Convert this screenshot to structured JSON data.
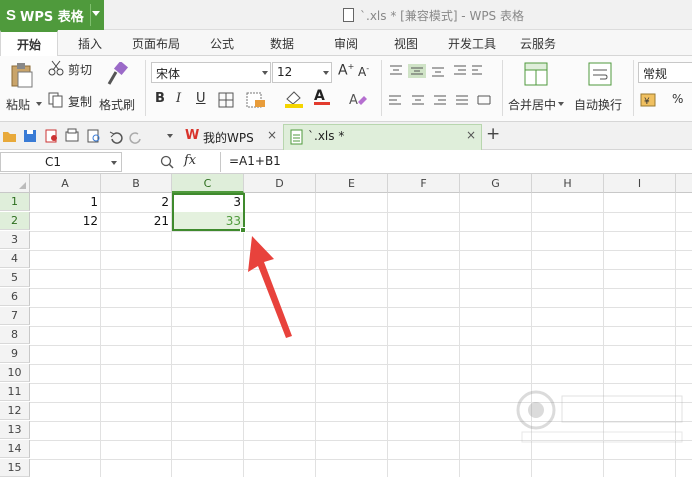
{
  "app": {
    "logo_label": "WPS 表格",
    "window_title": "`.xls * [兼容模式] - WPS 表格"
  },
  "menu": {
    "tabs": [
      "开始",
      "插入",
      "页面布局",
      "公式",
      "数据",
      "审阅",
      "视图",
      "开发工具",
      "云服务"
    ],
    "active": "开始"
  },
  "ribbon": {
    "paste": "粘贴",
    "cut": "剪切",
    "copy": "复制",
    "format_painter": "格式刷",
    "font_name": "宋体",
    "font_size": "12",
    "bold": "B",
    "italic": "I",
    "underline": "U",
    "merge_center": "合并居中",
    "wrap_text": "自动换行",
    "number_format": "常规",
    "percent": "%"
  },
  "doc_tabs": [
    {
      "label": "我的WPS",
      "close": "×"
    },
    {
      "label": "`.xls *",
      "close": "×"
    }
  ],
  "add_tab": "+",
  "formula_bar": {
    "name_box": "C1",
    "fx": "fx",
    "formula": "=A1+B1"
  },
  "sheet": {
    "columns": [
      "A",
      "B",
      "C",
      "D",
      "E",
      "F",
      "G",
      "H",
      "I"
    ],
    "rows": [
      "1",
      "2",
      "3",
      "4",
      "5",
      "6",
      "7",
      "8",
      "9",
      "10",
      "11",
      "12",
      "13",
      "14",
      "15"
    ],
    "cells": {
      "A1": "1",
      "B1": "2",
      "C1": "3",
      "A2": "12",
      "B2": "21",
      "C2": "33"
    },
    "selected_column": "C"
  },
  "colors": {
    "brand_green": "#4f9a3c",
    "arrow_red": "#e8423c"
  }
}
